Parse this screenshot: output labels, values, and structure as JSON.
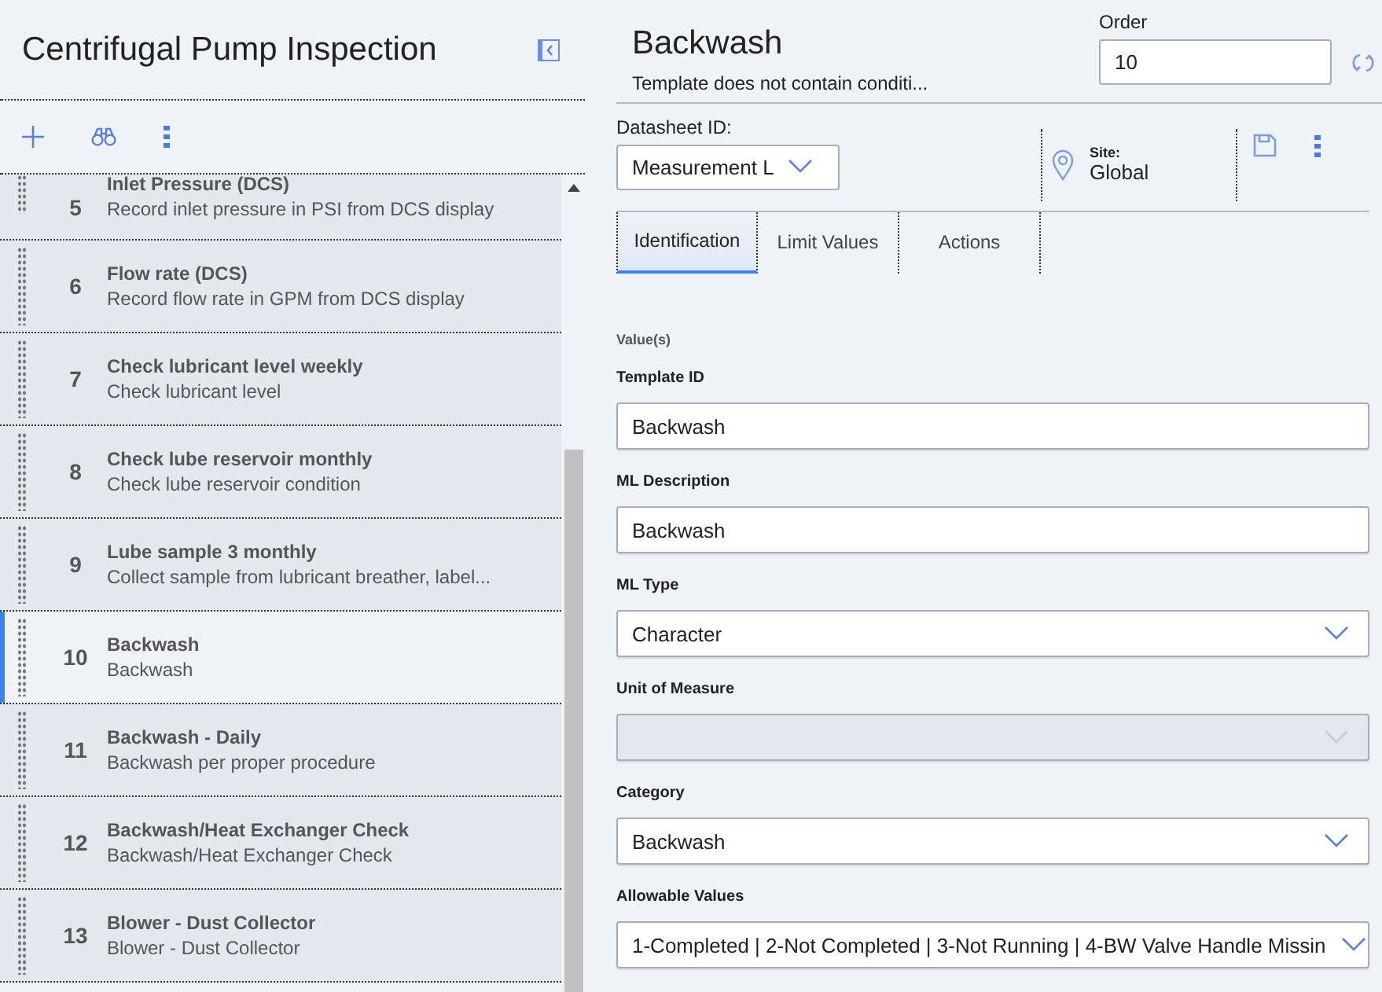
{
  "left_panel": {
    "title": "Centrifugal Pump Inspection",
    "steps": [
      {
        "number": "5",
        "title": "Inlet Pressure (DCS)",
        "description": "Record inlet pressure in PSI from DCS display",
        "selected": false
      },
      {
        "number": "6",
        "title": "Flow rate (DCS)",
        "description": "Record flow rate in GPM from DCS display",
        "selected": false
      },
      {
        "number": "7",
        "title": "Check lubricant level weekly",
        "description": "Check lubricant level",
        "selected": false
      },
      {
        "number": "8",
        "title": "Check lube reservoir monthly",
        "description": "Check lube reservoir condition",
        "selected": false
      },
      {
        "number": "9",
        "title": "Lube sample 3 monthly",
        "description": "Collect sample from lubricant breather, label...",
        "selected": false
      },
      {
        "number": "10",
        "title": "Backwash",
        "description": "Backwash",
        "selected": true
      },
      {
        "number": "11",
        "title": "Backwash - Daily",
        "description": "Backwash per proper procedure",
        "selected": false
      },
      {
        "number": "12",
        "title": "Backwash/Heat Exchanger Check",
        "description": "Backwash/Heat Exchanger Check",
        "selected": false
      },
      {
        "number": "13",
        "title": "Blower - Dust Collector",
        "description": "Blower - Dust Collector",
        "selected": false
      }
    ]
  },
  "detail": {
    "title": "Backwash",
    "subtitle": "Template does not contain conditi...",
    "order": {
      "label": "Order",
      "value": "10"
    },
    "datasheet": {
      "label": "Datasheet ID:",
      "value": "Measurement L"
    },
    "site": {
      "label": "Site:",
      "value": "Global"
    },
    "tabs": [
      {
        "label": "Identification",
        "selected": true
      },
      {
        "label": "Limit Values",
        "selected": false
      },
      {
        "label": "Actions",
        "selected": false
      }
    ],
    "section_label": "Value(s)",
    "fields": [
      {
        "label": "Template ID",
        "kind": "text",
        "value": "Backwash",
        "disabled": false
      },
      {
        "label": "ML Description",
        "kind": "text",
        "value": "Backwash",
        "disabled": false
      },
      {
        "label": "ML Type",
        "kind": "select",
        "value": "Character",
        "disabled": false
      },
      {
        "label": "Unit of Measure",
        "kind": "select",
        "disabled": true
      },
      {
        "label": "Category",
        "kind": "select",
        "value": "Backwash",
        "disabled": false
      },
      {
        "label": "Allowable Values",
        "kind": "select",
        "value": "1-Completed | 2-Not Completed | 3-Not Running | 4-BW Valve Handle Missin",
        "disabled": false
      }
    ]
  }
}
